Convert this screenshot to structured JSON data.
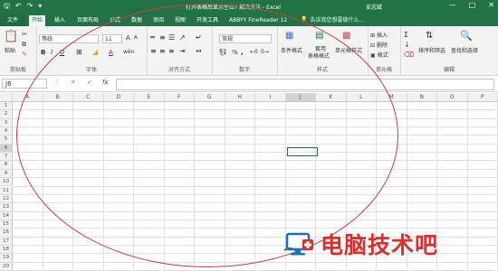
{
  "window": {
    "title": "打开表格后显示空白? 解决方法 - Excel",
    "user": "安志斌",
    "qat_icons": [
      "save-icon",
      "undo-icon",
      "redo-icon",
      "customize-icon"
    ],
    "controls": [
      "minimize-icon",
      "restore-icon",
      "close-icon"
    ]
  },
  "tabs": [
    "文件",
    "开始",
    "插入",
    "页面布局",
    "公式",
    "数据",
    "审阅",
    "视图",
    "开发工具",
    "ABBYY FineReader 12"
  ],
  "active_tab": "开始",
  "tell_me": "告诉我您想要做什么...",
  "ribbon": {
    "clipboard": {
      "paste": "粘贴",
      "label": "剪贴板"
    },
    "font": {
      "name": "等线",
      "size": "11",
      "grow": "A",
      "shrink": "A",
      "bold": "B",
      "italic": "I",
      "underline": "U",
      "font_color": "A",
      "phonetic": "wén",
      "label": "字体"
    },
    "alignment": {
      "label": "对齐方式"
    },
    "number": {
      "format": "常规",
      "percent": "%",
      "comma": ",",
      "label": "数字"
    },
    "styles": {
      "conditional": "条件格式",
      "table_line1": "套用",
      "table_line2": "表格格式",
      "cell_styles": "单元格样式",
      "label": "样式"
    },
    "cells": {
      "insert": "插入",
      "delete": "删除",
      "format": "格式",
      "label": "单元格"
    },
    "editing": {
      "sort": "排序和筛选",
      "find": "查找和选择",
      "label": "编辑"
    }
  },
  "formula_bar": {
    "name_box": "J6",
    "cancel": "✕",
    "enter": "✓",
    "fx": "fx",
    "value": ""
  },
  "sheet": {
    "columns": [
      "A",
      "B",
      "C",
      "D",
      "E",
      "F",
      "G",
      "H",
      "I",
      "J",
      "K",
      "L",
      "M",
      "N",
      "O",
      "P"
    ],
    "rows": [
      "1",
      "2",
      "3",
      "4",
      "5",
      "6",
      "7",
      "8",
      "9",
      "10",
      "11",
      "12",
      "13",
      "14",
      "15",
      "16",
      "17",
      "18",
      "19",
      "20"
    ],
    "active_column": "J",
    "active_row": "6"
  },
  "annotation_color": "#d23a3a",
  "brand_color": "#217346",
  "watermark": {
    "text": "电脑技术吧"
  }
}
